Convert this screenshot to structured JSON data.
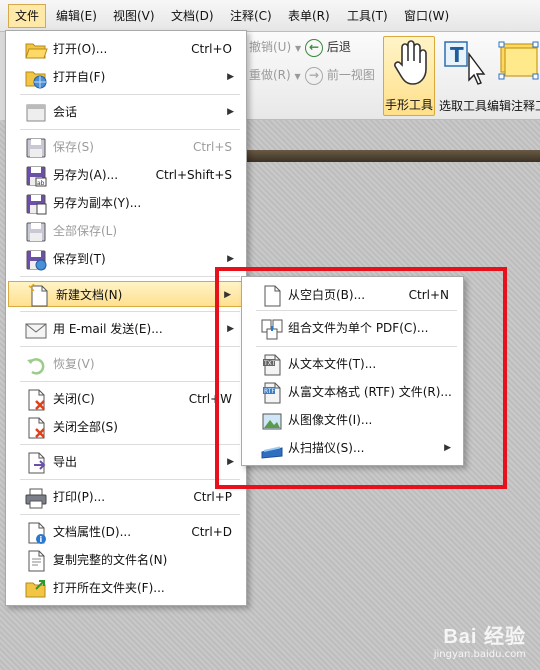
{
  "menubar": {
    "items": [
      "文件",
      "编辑(E)",
      "视图(V)",
      "文档(D)",
      "注释(C)",
      "表单(R)",
      "工具(T)",
      "窗口(W)"
    ]
  },
  "toolbar": {
    "undo": "撤销(U)",
    "redo": "重做(R)",
    "back": "后退",
    "forward": "前一视图",
    "hand_tool": "手形工具",
    "select_text": "选取工具",
    "edit_annot": "编辑注释工"
  },
  "file_menu": {
    "items": [
      {
        "label": "打开(O)...",
        "shortcut": "Ctrl+O",
        "icon": "folder-open-icon"
      },
      {
        "label": "打开自(F)",
        "icon": "folder-globe-icon",
        "submenu": true
      },
      {
        "label": "会话",
        "icon": "session-icon",
        "submenu": true
      },
      {
        "label": "保存(S)",
        "shortcut": "Ctrl+S",
        "icon": "save-icon",
        "disabled": true
      },
      {
        "label": "另存为(A)...",
        "shortcut": "Ctrl+Shift+S",
        "icon": "save-as-icon"
      },
      {
        "label": "另存为副本(Y)...",
        "icon": "save-copy-icon"
      },
      {
        "label": "全部保存(L)",
        "icon": "save-all-icon",
        "disabled": true
      },
      {
        "label": "保存到(T)",
        "icon": "save-to-icon",
        "submenu": true
      },
      {
        "label": "新建文档(N)",
        "icon": "new-document-icon",
        "submenu": true,
        "highlighted": true
      },
      {
        "label": "用 E-mail 发送(E)...",
        "icon": "email-icon",
        "submenu": true
      },
      {
        "label": "恢复(V)",
        "icon": "revert-icon",
        "disabled": true
      },
      {
        "label": "关闭(C)",
        "shortcut": "Ctrl+W",
        "icon": "close-doc-icon"
      },
      {
        "label": "关闭全部(S)",
        "icon": "close-all-icon"
      },
      {
        "label": "导出",
        "icon": "export-icon",
        "submenu": true
      },
      {
        "label": "打印(P)...",
        "shortcut": "Ctrl+P",
        "icon": "printer-icon"
      },
      {
        "label": "文档属性(D)...",
        "shortcut": "Ctrl+D",
        "icon": "document-properties-icon"
      },
      {
        "label": "复制完整的文件名(N)",
        "icon": "copy-filename-icon"
      },
      {
        "label": "打开所在文件夹(F)...",
        "icon": "open-folder-icon"
      }
    ]
  },
  "submenu": {
    "items": [
      {
        "label": "从空白页(B)...",
        "shortcut": "Ctrl+N",
        "icon": "blank-page-icon"
      },
      {
        "label": "组合文件为单个 PDF(C)...",
        "icon": "combine-pdf-icon"
      },
      {
        "label": "从文本文件(T)...",
        "icon": "text-file-icon"
      },
      {
        "label": "从富文本格式 (RTF) 文件(R)...",
        "icon": "rtf-file-icon"
      },
      {
        "label": "从图像文件(I)...",
        "icon": "image-file-icon"
      },
      {
        "label": "从扫描仪(S)...",
        "icon": "scanner-icon",
        "submenu": true
      }
    ]
  },
  "watermark": {
    "logo": "Bai 经验",
    "url": "jingyan.baidu.com"
  },
  "colors": {
    "highlight": "#ffe08f",
    "annotation_red": "#e8101a"
  }
}
